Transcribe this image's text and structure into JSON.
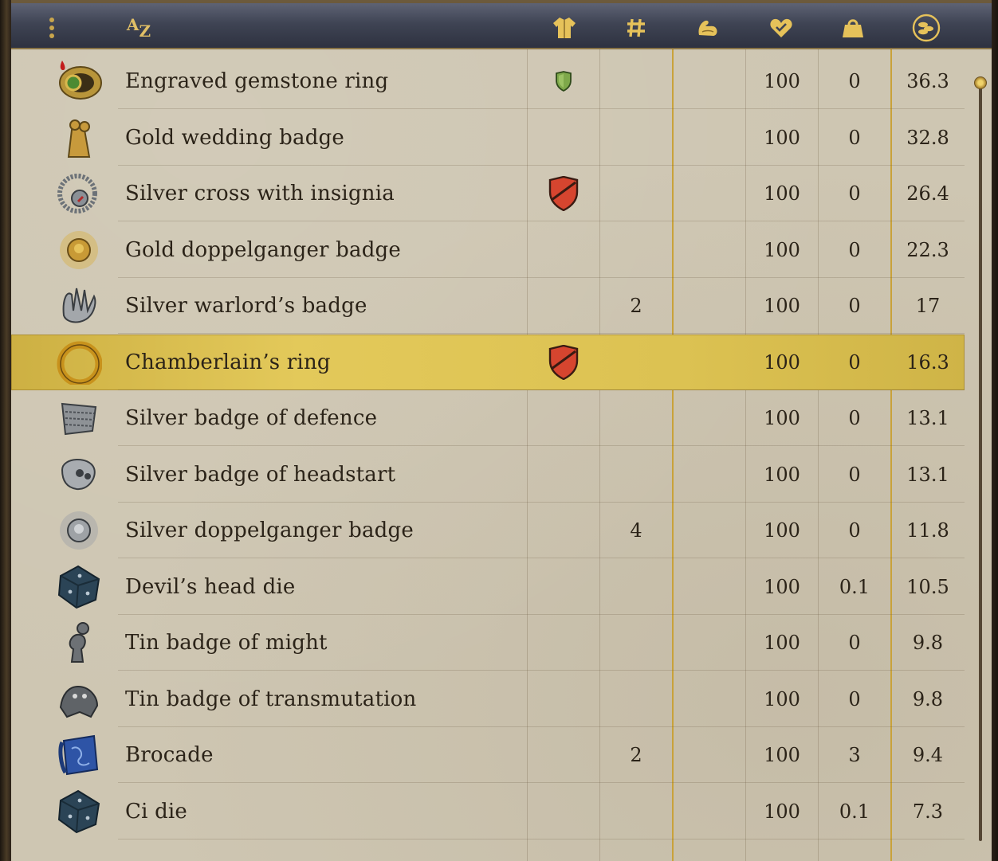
{
  "header": {
    "menu_icon": "menu-dots-icon",
    "sort_label_a": "A",
    "sort_label_z": "Z",
    "columns": [
      {
        "icon": "armor-icon"
      },
      {
        "icon": "hash-icon"
      },
      {
        "icon": "strength-arm-icon"
      },
      {
        "icon": "heart-health-icon"
      },
      {
        "icon": "weight-icon"
      },
      {
        "icon": "coins-price-icon"
      }
    ]
  },
  "colors": {
    "accent_gold": "#e6c25a",
    "parchment": "#cec6b2",
    "selected_row": "#dcc252",
    "shield_red": "#d6452f",
    "shield_green": "#7ea84a"
  },
  "rows": [
    {
      "icon": "gemstone-ring-icon",
      "name": "Engraved gemstone ring",
      "armor": "shield-green",
      "count": "",
      "hp": "100",
      "weight": "0",
      "price": "36.3"
    },
    {
      "icon": "wedding-badge-icon",
      "name": "Gold wedding badge",
      "armor": "",
      "count": "",
      "hp": "100",
      "weight": "0",
      "price": "32.8"
    },
    {
      "icon": "silver-cross-icon",
      "name": "Silver cross with insignia",
      "armor": "shield-red",
      "count": "",
      "hp": "100",
      "weight": "0",
      "price": "26.4"
    },
    {
      "icon": "gold-sun-badge-icon",
      "name": "Gold doppelganger badge",
      "armor": "",
      "count": "",
      "hp": "100",
      "weight": "0",
      "price": "22.3"
    },
    {
      "icon": "warlord-badge-icon",
      "name": "Silver warlord’s badge",
      "armor": "",
      "count": "2",
      "hp": "100",
      "weight": "0",
      "price": "17"
    },
    {
      "icon": "gold-ring-icon",
      "name": "Chamberlain’s ring",
      "armor": "shield-red",
      "count": "",
      "hp": "100",
      "weight": "0",
      "price": "16.3",
      "selected": true
    },
    {
      "icon": "mail-badge-icon",
      "name": "Silver badge of defence",
      "armor": "",
      "count": "",
      "hp": "100",
      "weight": "0",
      "price": "13.1"
    },
    {
      "icon": "skull-badge-icon",
      "name": "Silver badge of headstart",
      "armor": "",
      "count": "",
      "hp": "100",
      "weight": "0",
      "price": "13.1"
    },
    {
      "icon": "silver-sun-badge-icon",
      "name": "Silver doppelganger badge",
      "armor": "",
      "count": "4",
      "hp": "100",
      "weight": "0",
      "price": "11.8"
    },
    {
      "icon": "die-icon",
      "name": "Devil’s head die",
      "armor": "",
      "count": "",
      "hp": "100",
      "weight": "0.1",
      "price": "10.5"
    },
    {
      "icon": "tin-figure-icon",
      "name": "Tin badge of might",
      "armor": "",
      "count": "",
      "hp": "100",
      "weight": "0",
      "price": "9.8"
    },
    {
      "icon": "gargoyle-badge-icon",
      "name": "Tin badge of transmutation",
      "armor": "",
      "count": "",
      "hp": "100",
      "weight": "0",
      "price": "9.8"
    },
    {
      "icon": "brocade-cloth-icon",
      "name": "Brocade",
      "armor": "",
      "count": "2",
      "hp": "100",
      "weight": "3",
      "price": "9.4"
    },
    {
      "icon": "die-icon",
      "name": "Ci die",
      "armor": "",
      "count": "",
      "hp": "100",
      "weight": "0.1",
      "price": "7.3"
    }
  ],
  "scroll": {
    "position": 0.0
  }
}
